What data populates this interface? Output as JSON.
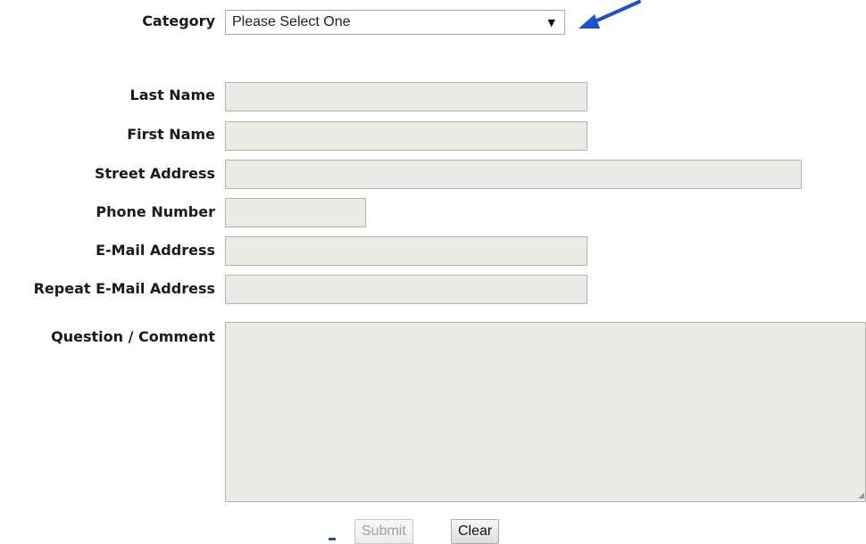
{
  "form": {
    "category": {
      "label": "Category",
      "selected": "Please Select One",
      "caret": "▼"
    },
    "last_name": {
      "label": "Last Name",
      "value": ""
    },
    "first_name": {
      "label": "First Name",
      "value": ""
    },
    "street_address": {
      "label": "Street Address",
      "value": ""
    },
    "phone_number": {
      "label": "Phone Number",
      "value": ""
    },
    "email": {
      "label": "E-Mail Address",
      "value": ""
    },
    "repeat_email": {
      "label": "Repeat E-Mail Address",
      "value": ""
    },
    "comment": {
      "label": "Question / Comment",
      "value": ""
    },
    "buttons": {
      "submit": "Submit",
      "clear": "Clear"
    }
  },
  "annotations": {
    "arrow_color": "#1e50d2",
    "arrow_icon": "pointer-arrow-icon"
  },
  "colors": {
    "field_background": "#ebebe6",
    "field_border": "#b3b3ad"
  }
}
